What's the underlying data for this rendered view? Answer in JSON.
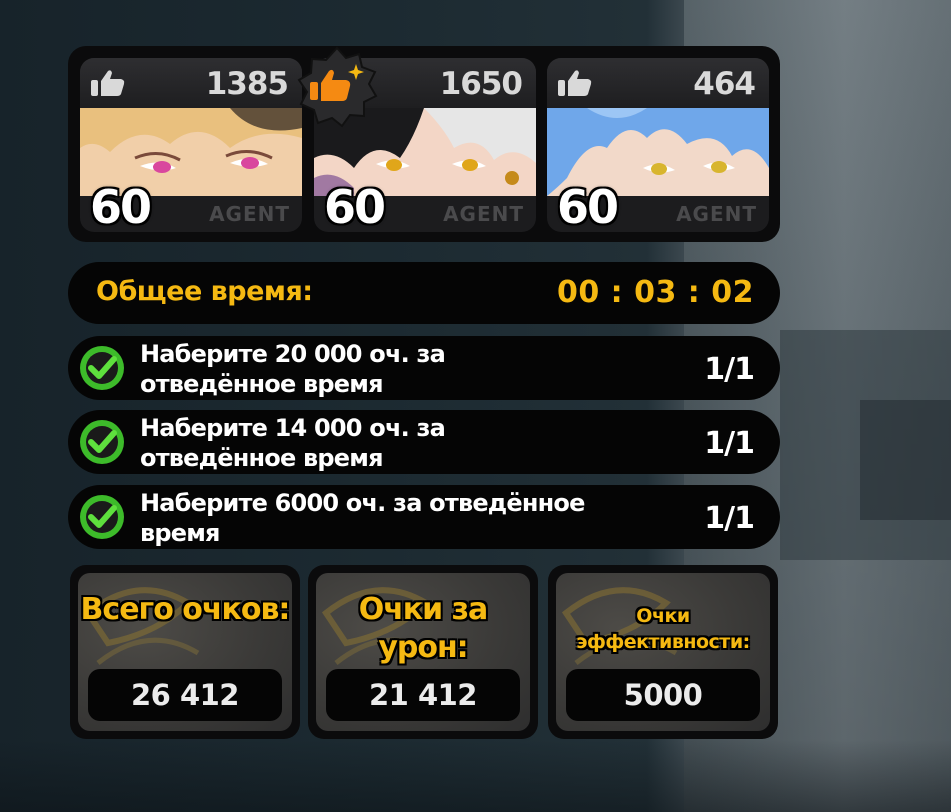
{
  "team": {
    "agents": [
      {
        "likes": "1385",
        "level": "60",
        "tag": "AGENT",
        "mvp": false,
        "hair": "#e9c07e",
        "eyes": "#d9479e"
      },
      {
        "likes": "1650",
        "level": "60",
        "tag": "AGENT",
        "mvp": true,
        "hair": "#e6e6e6",
        "eyes": "#e0a61a"
      },
      {
        "likes": "464",
        "level": "60",
        "tag": "AGENT",
        "mvp": false,
        "hair": "#6fa7ea",
        "eyes": "#d8b52e"
      }
    ]
  },
  "total_time": {
    "label": "Общее время:",
    "value": "00 : 03 : 02"
  },
  "objectives": [
    {
      "text": "Наберите 20 000 оч. за отведённое время",
      "progress": "1/1",
      "completed": true
    },
    {
      "text": "Наберите 14 000 оч. за отведённое время",
      "progress": "1/1",
      "completed": true
    },
    {
      "text": "Наберите 6000 оч. за отведённое время",
      "progress": "1/1",
      "completed": true
    }
  ],
  "scores": [
    {
      "title": "Всего очков:",
      "value": "26 412"
    },
    {
      "title": "Очки за урон:",
      "value": "21 412"
    },
    {
      "title": "Очки эффективности:",
      "value": "5000"
    }
  ],
  "icons": {
    "like": "thumbs-up-icon",
    "mvp": "mvp-thumbs-up-badge-icon",
    "check": "check-circle-icon"
  },
  "colors": {
    "accent": "#f5b912",
    "check_green": "#3dbb2a",
    "panel": "#050505"
  }
}
